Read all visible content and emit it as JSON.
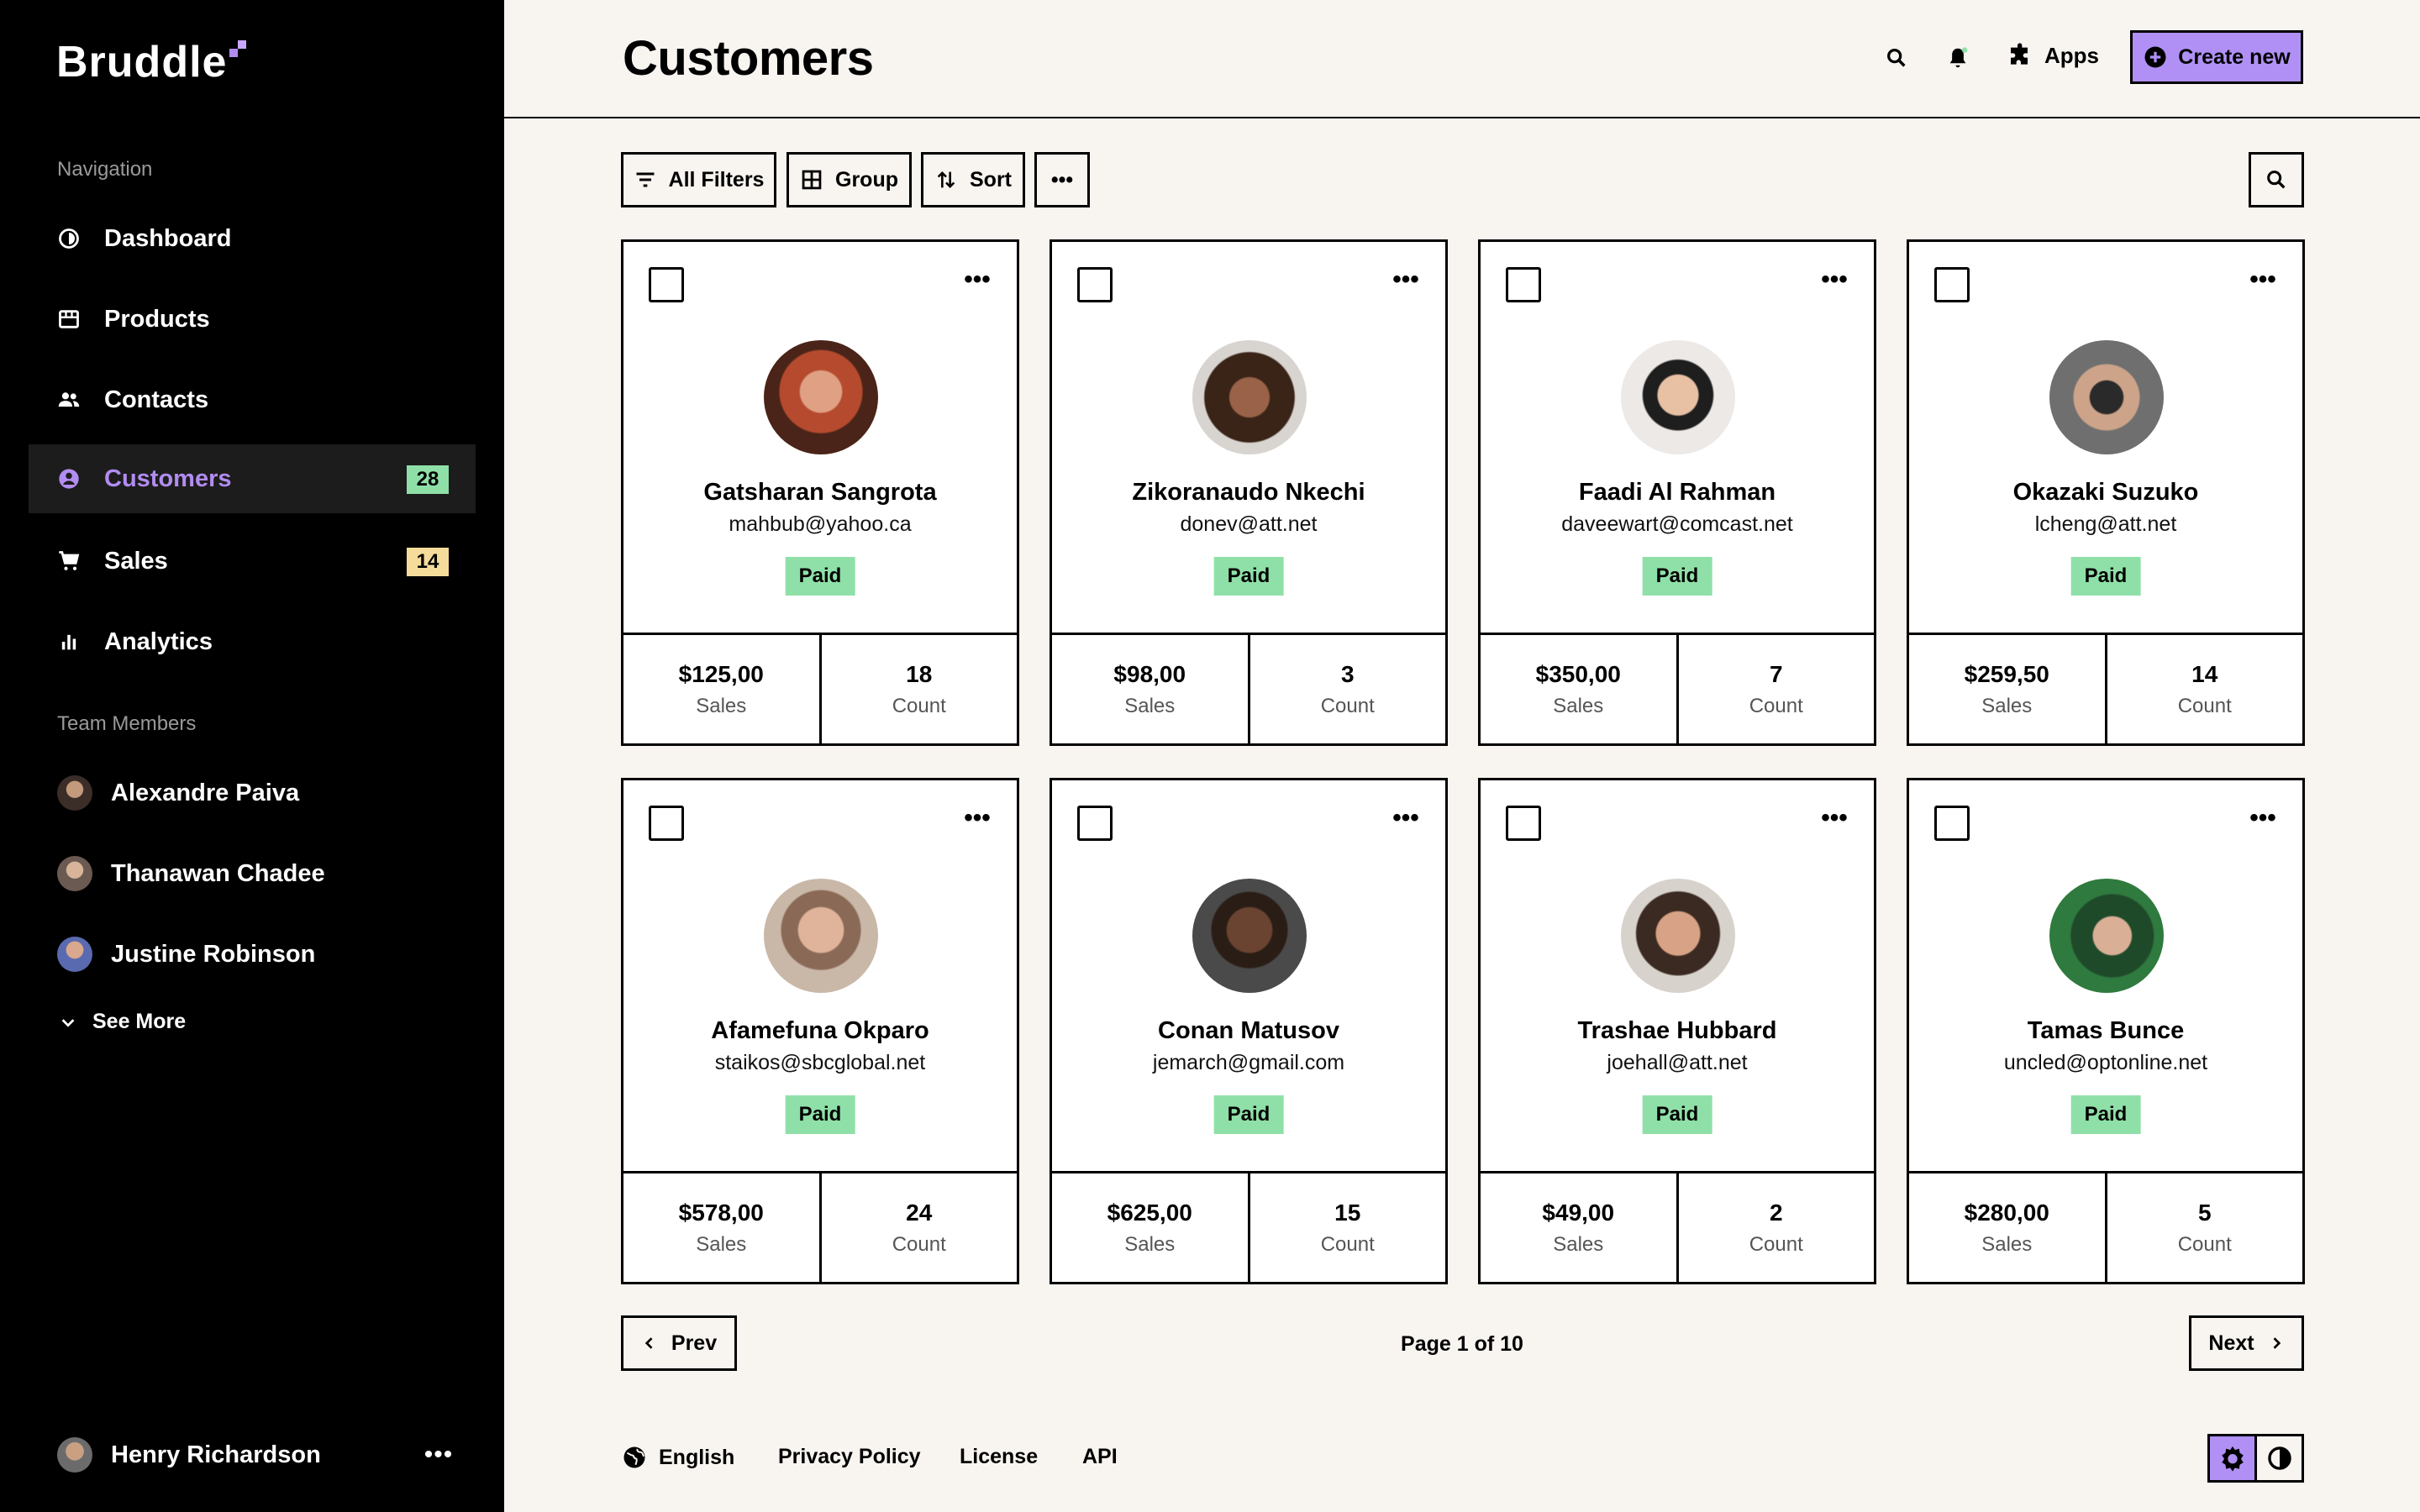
{
  "app": {
    "name": "Bruddle"
  },
  "sidebar": {
    "navigation_title": "Navigation",
    "items": [
      {
        "label": "Dashboard",
        "icon": "dashboard-icon"
      },
      {
        "label": "Products",
        "icon": "store-icon"
      },
      {
        "label": "Contacts",
        "icon": "people-icon"
      },
      {
        "label": "Customers",
        "icon": "account-circle-icon",
        "badge": "28",
        "badge_color": "#8fe0a8",
        "active": true
      },
      {
        "label": "Sales",
        "icon": "cart-icon",
        "badge": "14",
        "badge_color": "#f5dc9a"
      },
      {
        "label": "Analytics",
        "icon": "bar-chart-icon"
      }
    ],
    "team_title": "Team Members",
    "members": [
      {
        "name": "Alexandre Paiva"
      },
      {
        "name": "Thanawan Chadee"
      },
      {
        "name": "Justine Robinson"
      }
    ],
    "see_more": "See More",
    "user": {
      "name": "Henry Richardson",
      "more": "•••"
    }
  },
  "header": {
    "title": "Customers",
    "apps_label": "Apps",
    "create_label": "Create new"
  },
  "toolbar": {
    "filters_label": "All Filters",
    "group_label": "Group",
    "sort_label": "Sort",
    "more_label": "•••"
  },
  "customers": [
    {
      "name": "Gatsharan Sangrota",
      "email": "mahbub@yahoo.ca",
      "status": "Paid",
      "sales": "$125,00",
      "sales_label": "Sales",
      "count": "18",
      "count_label": "Count",
      "more": "•••"
    },
    {
      "name": "Zikoranaudo Nkechi",
      "email": "donev@att.net",
      "status": "Paid",
      "sales": "$98,00",
      "sales_label": "Sales",
      "count": "3",
      "count_label": "Count",
      "more": "•••"
    },
    {
      "name": "Faadi Al Rahman",
      "email": "daveewart@comcast.net",
      "status": "Paid",
      "sales": "$350,00",
      "sales_label": "Sales",
      "count": "7",
      "count_label": "Count",
      "more": "•••"
    },
    {
      "name": "Okazaki Suzuko",
      "email": "lcheng@att.net",
      "status": "Paid",
      "sales": "$259,50",
      "sales_label": "Sales",
      "count": "14",
      "count_label": "Count",
      "more": "•••"
    },
    {
      "name": "Afamefuna Okparo",
      "email": "staikos@sbcglobal.net",
      "status": "Paid",
      "sales": "$578,00",
      "sales_label": "Sales",
      "count": "24",
      "count_label": "Count",
      "more": "•••"
    },
    {
      "name": "Conan Matusov",
      "email": "jemarch@gmail.com",
      "status": "Paid",
      "sales": "$625,00",
      "sales_label": "Sales",
      "count": "15",
      "count_label": "Count",
      "more": "•••"
    },
    {
      "name": "Trashae Hubbard",
      "email": "joehall@att.net",
      "status": "Paid",
      "sales": "$49,00",
      "sales_label": "Sales",
      "count": "2",
      "count_label": "Count",
      "more": "•••"
    },
    {
      "name": "Tamas Bunce",
      "email": "uncled@optonline.net",
      "status": "Paid",
      "sales": "$280,00",
      "sales_label": "Sales",
      "count": "5",
      "count_label": "Count",
      "more": "•••"
    }
  ],
  "pagination": {
    "prev": "Prev",
    "next": "Next",
    "info": "Page 1 of 10"
  },
  "footer": {
    "language": "English",
    "privacy": "Privacy Policy",
    "license": "License",
    "api": "API"
  },
  "colors": {
    "accent": "#b090f5",
    "paid": "#8fe0a8",
    "sidebar_bg": "#000000",
    "page_bg": "#f8f4f0"
  }
}
